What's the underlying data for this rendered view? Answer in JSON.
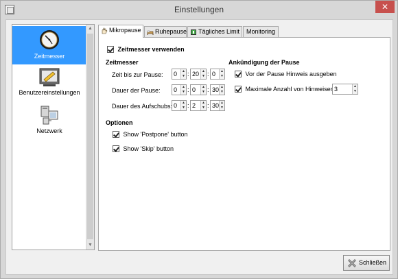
{
  "window": {
    "title": "Einstellungen",
    "close_glyph": "✕"
  },
  "sidebar": {
    "items": [
      {
        "label": "Zeitmesser",
        "icon": "clock-icon",
        "selected": true
      },
      {
        "label": "Benutzereinstellungen",
        "icon": "user-settings-icon",
        "selected": false
      },
      {
        "label": "Netzwerk",
        "icon": "network-icon",
        "selected": false
      }
    ],
    "scroll_up": "▲",
    "scroll_down": "▼"
  },
  "tabs": [
    {
      "label": "Mikropause",
      "icon": "hand-icon",
      "active": true
    },
    {
      "label": "Ruhepause",
      "icon": "bed-icon",
      "active": false
    },
    {
      "label": "Tägliches Limit",
      "icon": "limit-icon",
      "active": false
    },
    {
      "label": "Monitoring",
      "icon": "",
      "active": false
    }
  ],
  "micropause": {
    "use_timer": {
      "label": "Zeitmesser verwenden",
      "checked": true
    },
    "timer": {
      "heading": "Zeitmesser",
      "rows": [
        {
          "label": "Zeit bis zur Pause:",
          "h": "0",
          "m": "20",
          "s": "0"
        },
        {
          "label": "Dauer der Pause:",
          "h": "0",
          "m": "0",
          "s": "30"
        },
        {
          "label": "Dauer des Aufschubs:",
          "h": "0",
          "m": "2",
          "s": "30"
        }
      ]
    },
    "announcement": {
      "heading": "Ankündigung der Pause",
      "show_hint": {
        "label": "Vor der Pause Hinweis ausgeben",
        "checked": true
      },
      "max_hints": {
        "label": "Maximale Anzahl von Hinweisen:",
        "checked": true,
        "value": "3"
      }
    },
    "options": {
      "heading": "Optionen",
      "postpone": {
        "label": "Show 'Postpone' button",
        "checked": true
      },
      "skip": {
        "label": "Show 'Skip' button",
        "checked": true
      }
    }
  },
  "footer": {
    "close_button_label": "Schließen"
  },
  "colors": {
    "selection": "#3399ff",
    "close": "#c7504d"
  }
}
